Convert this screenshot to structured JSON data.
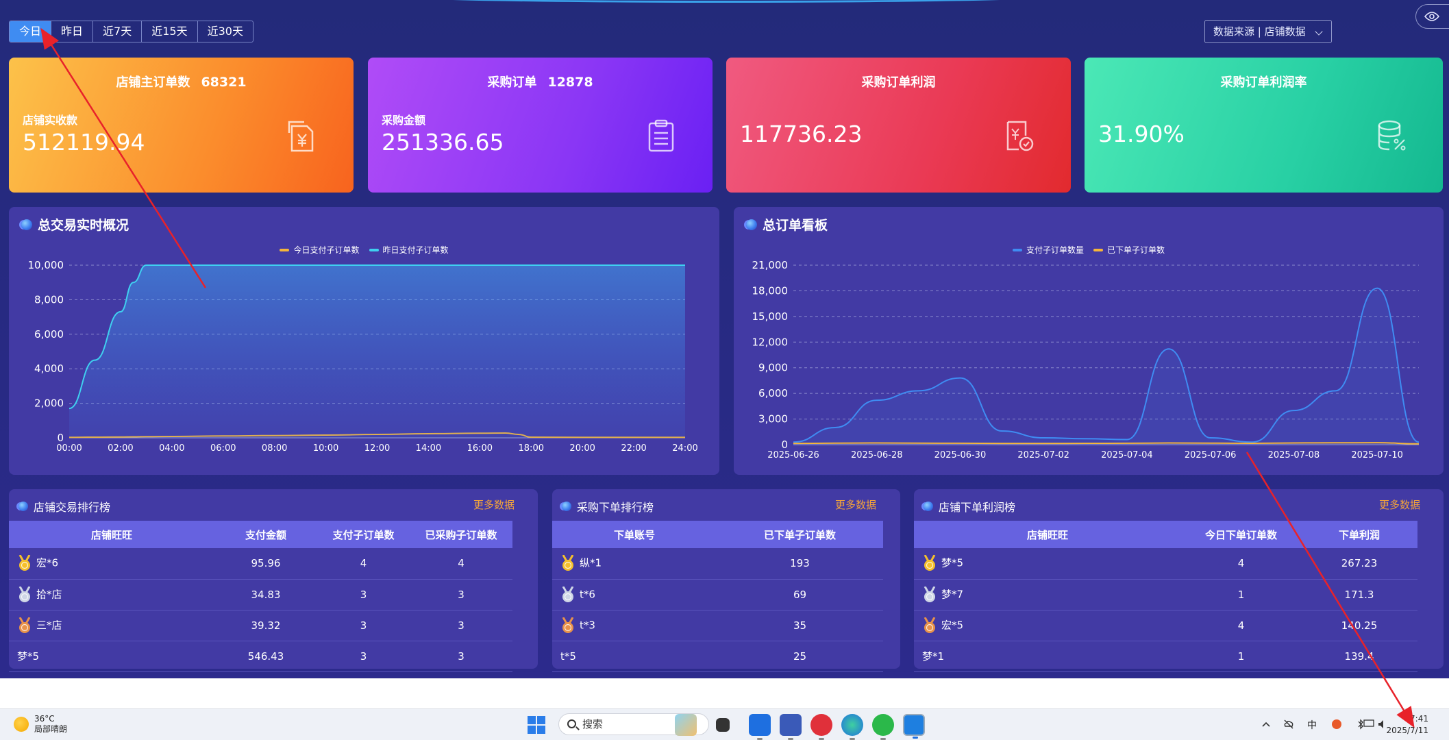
{
  "filters": {
    "tabs": [
      "今日",
      "昨日",
      "近7天",
      "近15天",
      "近30天"
    ],
    "active_index": 0,
    "datasource_label": "数据来源 | 店铺数据"
  },
  "cards": [
    {
      "title": "店铺主订单数",
      "title_value": "68321",
      "sub": "店铺实收款",
      "value": "512119.94",
      "icon": "yuan-document-icon"
    },
    {
      "title": "采购订单",
      "title_value": "12878",
      "sub": "采购金额",
      "value": "251336.65",
      "icon": "clipboard-icon"
    },
    {
      "title": "采购订单利润",
      "title_value": "",
      "sub": "",
      "value": "117736.23",
      "icon": "invoice-check-icon"
    },
    {
      "title": "采购订单利润率",
      "title_value": "",
      "sub": "",
      "value": "31.90%",
      "icon": "database-percent-icon"
    }
  ],
  "panel_left": {
    "title": "总交易实时概况",
    "legend": [
      "今日支付子订单数",
      "昨日支付子订单数"
    ]
  },
  "panel_right": {
    "title": "总订单看板",
    "legend": [
      "支付子订单数量",
      "已下单子订单数"
    ]
  },
  "chart_data": [
    {
      "type": "area",
      "x": [
        "00:00",
        "01:00",
        "02:00",
        "02:30",
        "03:00",
        "04:00",
        "06:00",
        "08:00",
        "10:00",
        "12:00",
        "14:00",
        "16:00",
        "17:00",
        "17:30",
        "18:00",
        "20:00",
        "22:00",
        "24:00"
      ],
      "xticks": [
        "00:00",
        "02:00",
        "04:00",
        "06:00",
        "08:00",
        "10:00",
        "12:00",
        "14:00",
        "16:00",
        "18:00",
        "20:00",
        "22:00",
        "24:00"
      ],
      "yticks": [
        "0",
        "2,000",
        "4,000",
        "6,000",
        "8,000",
        "10,000"
      ],
      "ylim": [
        0,
        10000
      ],
      "grid": true,
      "legend_position": "top-center",
      "series": [
        {
          "name": "今日支付子订单数",
          "color": "#f5b53a",
          "values": [
            30,
            40,
            50,
            60,
            70,
            80,
            110,
            130,
            160,
            200,
            240,
            270,
            280,
            200,
            40,
            30,
            30,
            30
          ]
        },
        {
          "name": "昨日支付子订单数",
          "color": "#3fd0f0",
          "values": [
            1700,
            4500,
            7300,
            9000,
            10000,
            10000,
            10000,
            10000,
            10000,
            10000,
            10000,
            10000,
            10000,
            10000,
            10000,
            10000,
            10000,
            10000
          ]
        }
      ]
    },
    {
      "type": "line",
      "x": [
        "2025-06-26",
        "2025-06-27",
        "2025-06-28",
        "2025-06-29",
        "2025-06-30",
        "2025-07-01",
        "2025-07-02",
        "2025-07-03",
        "2025-07-04",
        "2025-07-05",
        "2025-07-06",
        "2025-07-07",
        "2025-07-08",
        "2025-07-09",
        "2025-07-10",
        "2025-07-11"
      ],
      "xticks": [
        "2025-06-26",
        "2025-06-28",
        "2025-06-30",
        "2025-07-02",
        "2025-07-04",
        "2025-07-06",
        "2025-07-08",
        "2025-07-10"
      ],
      "yticks": [
        "0",
        "3,000",
        "6,000",
        "9,000",
        "12,000",
        "15,000",
        "18,000",
        "21,000"
      ],
      "ylim": [
        0,
        21000
      ],
      "grid": true,
      "legend_position": "top-center",
      "series": [
        {
          "name": "支付子订单数量",
          "color": "#3f8cf2",
          "values": [
            300,
            2000,
            5200,
            6300,
            7800,
            1600,
            800,
            700,
            600,
            11200,
            800,
            300,
            4000,
            6300,
            18300,
            300
          ]
        },
        {
          "name": "已下单子订单数",
          "color": "#f5b53a",
          "values": [
            150,
            180,
            200,
            180,
            170,
            150,
            150,
            160,
            170,
            200,
            180,
            160,
            200,
            220,
            230,
            100
          ]
        }
      ]
    }
  ],
  "tables": [
    {
      "title": "店铺交易排行榜",
      "more": "更多数据",
      "headers": [
        "店铺旺旺",
        "支付金额",
        "支付子订单数",
        "已采购子订单数"
      ],
      "rows": [
        [
          "宏*6",
          "95.96",
          "4",
          "4"
        ],
        [
          "拾*店",
          "34.83",
          "3",
          "3"
        ],
        [
          "三*店",
          "39.32",
          "3",
          "3"
        ],
        [
          "梦*5",
          "546.43",
          "3",
          "3"
        ]
      ]
    },
    {
      "title": "采购下单排行榜",
      "more": "更多数据",
      "headers": [
        "下单账号",
        "已下单子订单数"
      ],
      "rows": [
        [
          "纵*1",
          "193"
        ],
        [
          "t*6",
          "69"
        ],
        [
          "t*3",
          "35"
        ],
        [
          "t*5",
          "25"
        ]
      ]
    },
    {
      "title": "店铺下单利润榜",
      "more": "更多数据",
      "headers": [
        "店铺旺旺",
        "今日下单订单数",
        "下单利润"
      ],
      "rows": [
        [
          "梦*5",
          "4",
          "267.23"
        ],
        [
          "梦*7",
          "1",
          "171.3"
        ],
        [
          "宏*5",
          "4",
          "140.25"
        ],
        [
          "梦*1",
          "1",
          "139.4"
        ]
      ]
    }
  ],
  "medal_colors": [
    "#f5c02c",
    "#cfd6e6",
    "#e8924a"
  ],
  "taskbar": {
    "temperature": "36°C",
    "weather": "局部晴朗",
    "search_placeholder": "搜索",
    "time": "17:41",
    "date": "2025/7/11"
  }
}
